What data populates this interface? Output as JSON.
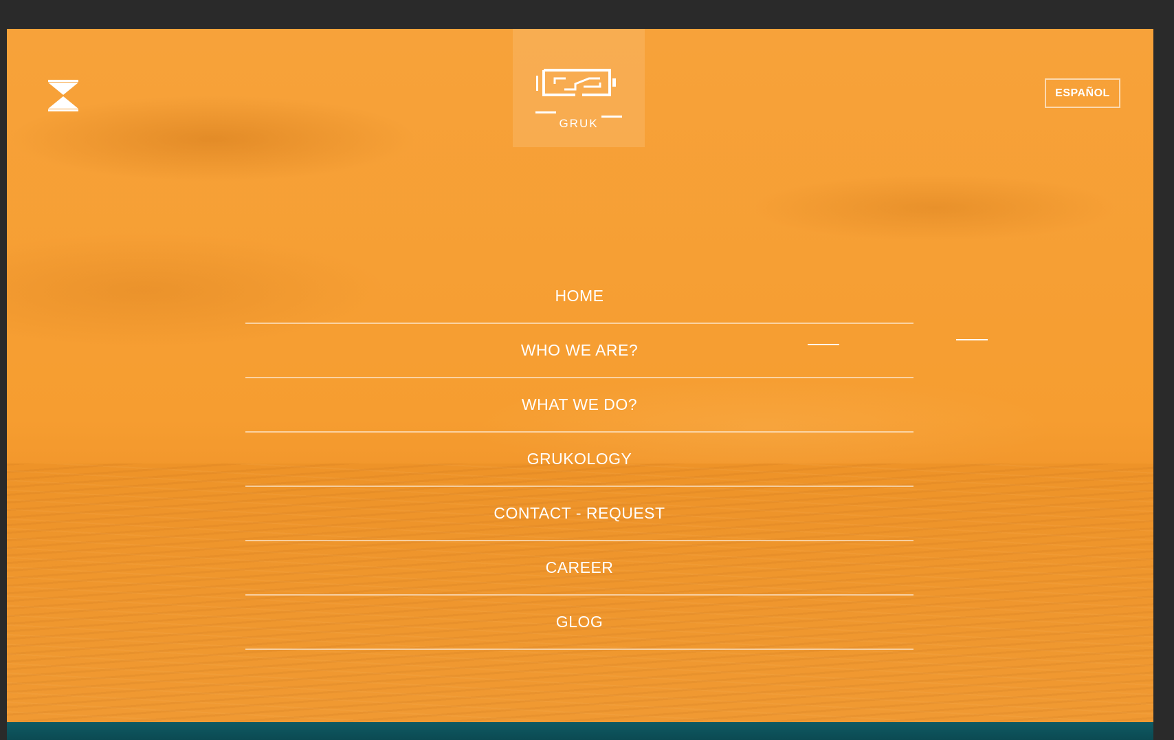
{
  "header": {
    "logo_text": "GRUK",
    "language_label": "ESPAÑOL"
  },
  "menu": {
    "items": [
      {
        "label": "HOME"
      },
      {
        "label": "WHO WE ARE?"
      },
      {
        "label": "WHAT WE DO?"
      },
      {
        "label": "GRUKOLOGY"
      },
      {
        "label": "CONTACT - REQUEST"
      },
      {
        "label": "CAREER"
      },
      {
        "label": "GLOG"
      }
    ],
    "active_index": 1
  },
  "colors": {
    "background_overlay": "#f69d30",
    "text": "#ffffff",
    "footer_band": "#0f5a63"
  },
  "icons": {
    "menu_toggle": "hourglass-menu-icon",
    "logo": "gruk-logo-icon"
  }
}
